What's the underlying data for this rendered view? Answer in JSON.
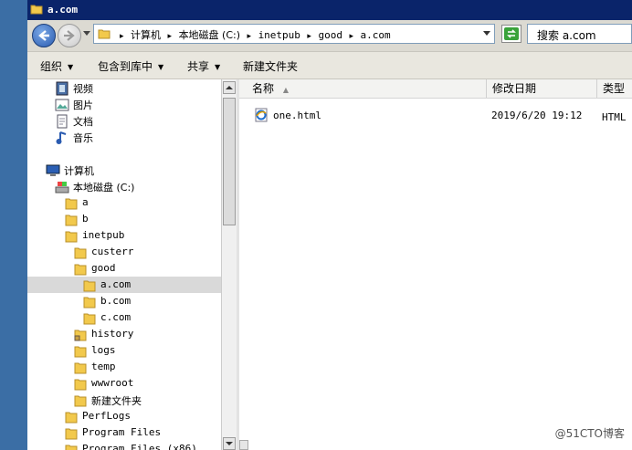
{
  "window": {
    "title": "a.com"
  },
  "address": {
    "crumbs": [
      "计算机",
      "本地磁盘 (C:)",
      "inetpub",
      "good",
      "a.com"
    ]
  },
  "search": {
    "text": "搜索 a.com"
  },
  "toolbar": {
    "organize": "组织",
    "include_in_library": "包含到库中",
    "share": "共享",
    "new_folder": "新建文件夹"
  },
  "nav_tree": {
    "libraries": [
      {
        "label": "视频",
        "icon": "video-library-icon"
      },
      {
        "label": "图片",
        "icon": "pictures-library-icon"
      },
      {
        "label": "文档",
        "icon": "documents-library-icon"
      },
      {
        "label": "音乐",
        "icon": "music-library-icon"
      }
    ],
    "computer": "计算机",
    "drive": "本地磁盘 (C:)",
    "folders_level1": [
      "a",
      "b",
      "inetpub"
    ],
    "inetpub_children": [
      "custerr",
      "good"
    ],
    "good_children": [
      "a.com",
      "b.com",
      "c.com"
    ],
    "inetpub_more": [
      "history",
      "logs",
      "temp",
      "wwwroot",
      "新建文件夹"
    ],
    "root_more": [
      "PerfLogs",
      "Program Files",
      "Program Files (x86)"
    ],
    "selected": "a.com"
  },
  "columns": {
    "name": "名称",
    "date": "修改日期",
    "type": "类型"
  },
  "files": [
    {
      "name": "one.html",
      "date": "2019/6/20 19:12",
      "type": "HTML 文"
    }
  ],
  "watermark": "@51CTO博客",
  "colors": {
    "titlebar": "#0a246a",
    "desktop": "#3a6ea5",
    "selection": "#d9d9d9"
  }
}
